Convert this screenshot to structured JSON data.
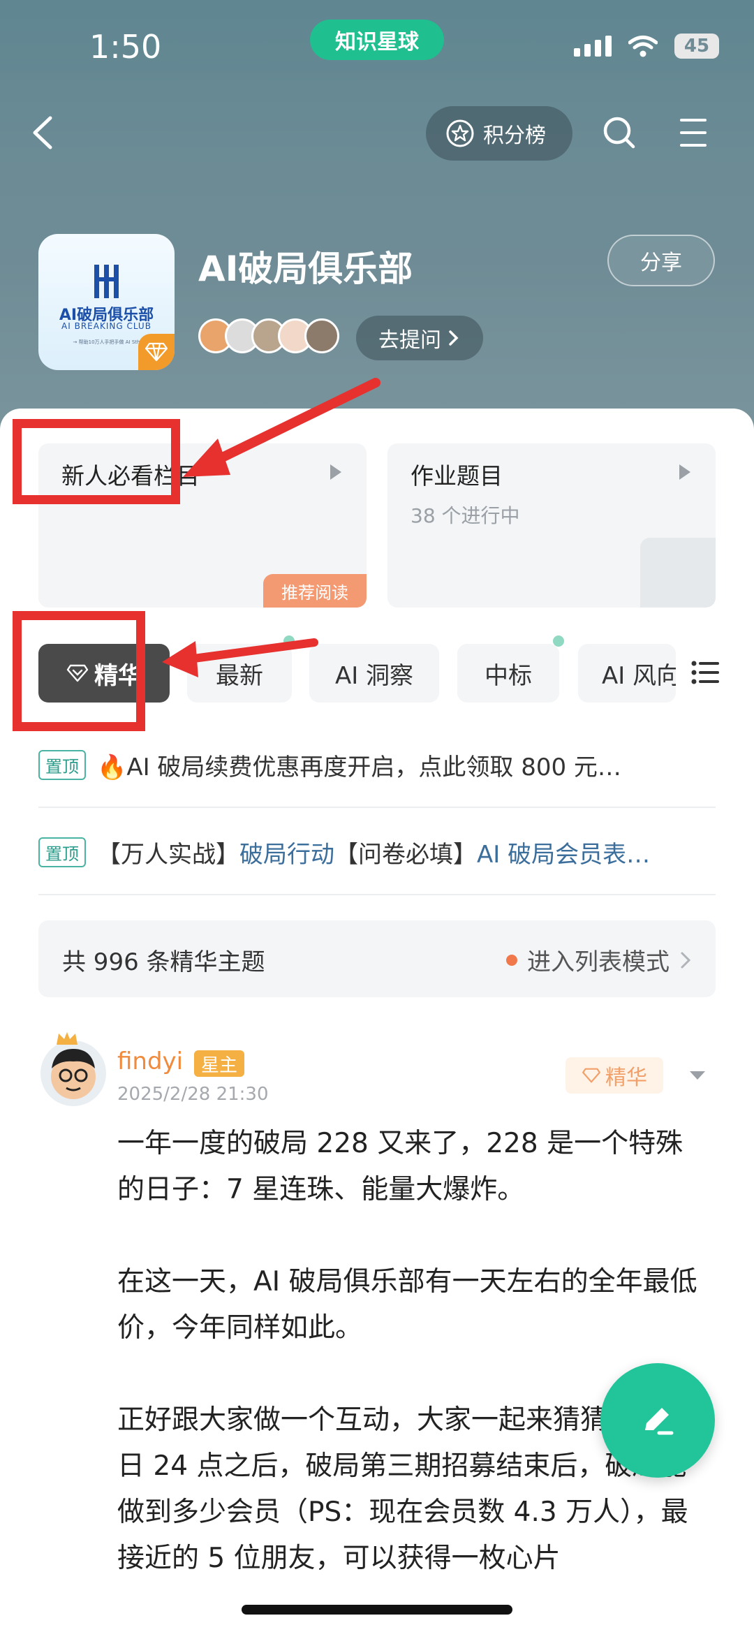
{
  "status_bar": {
    "time": "1:50",
    "app_name": "知识星球",
    "battery": "45"
  },
  "nav": {
    "points_label": "积分榜"
  },
  "group": {
    "name": "AI破局俱乐部",
    "share_label": "分享",
    "ask_label": "去提问",
    "logo_cn": "AI破局俱乐部",
    "logo_en": "AI BREAKING CLUB",
    "logo_small": "→ 帮助10万人手把手做 AI Sth"
  },
  "cards": [
    {
      "title": "新人必看栏目",
      "subtitle": "",
      "tag": "推荐阅读"
    },
    {
      "title": "作业题目",
      "subtitle": "38 个进行中"
    }
  ],
  "tabs": [
    "精华",
    "最新",
    "AI 洞察",
    "中标",
    "AI 风向"
  ],
  "pinned": {
    "tag": "置顶",
    "item1": "🔥AI 破局续费优惠再度开启，点此领取 800 元…",
    "item2_a": "【万人实战】",
    "item2_b": "破局行动",
    "item2_c": "【问卷必填】",
    "item2_d": "AI 破局会员表…"
  },
  "summary": {
    "left": "共 996 条精华主题",
    "right": "进入列表模式"
  },
  "post": {
    "author": "findyi",
    "role": "星主",
    "time": "2025/2/28 21:30",
    "badge": "精华",
    "p1": "一年一度的破局 228 又来了，228 是一个特殊的日子：7 星连珠、能量大爆炸。",
    "p2": "在这一天，AI 破局俱乐部有一天左右的全年最低价，今年同样如此。",
    "p3": "正好跟大家做一个互动，大家一起来猜猜：3月3日 24 点之后，破局第三期招募结束后，破局能做到多少会员（PS：现在会员数 4.3 万人），最接近的 5 位朋友，可以获得一枚心片"
  },
  "colors": {
    "accent": "#22c59a",
    "highlight_red": "#e6312f",
    "header": "#6b8b95"
  }
}
